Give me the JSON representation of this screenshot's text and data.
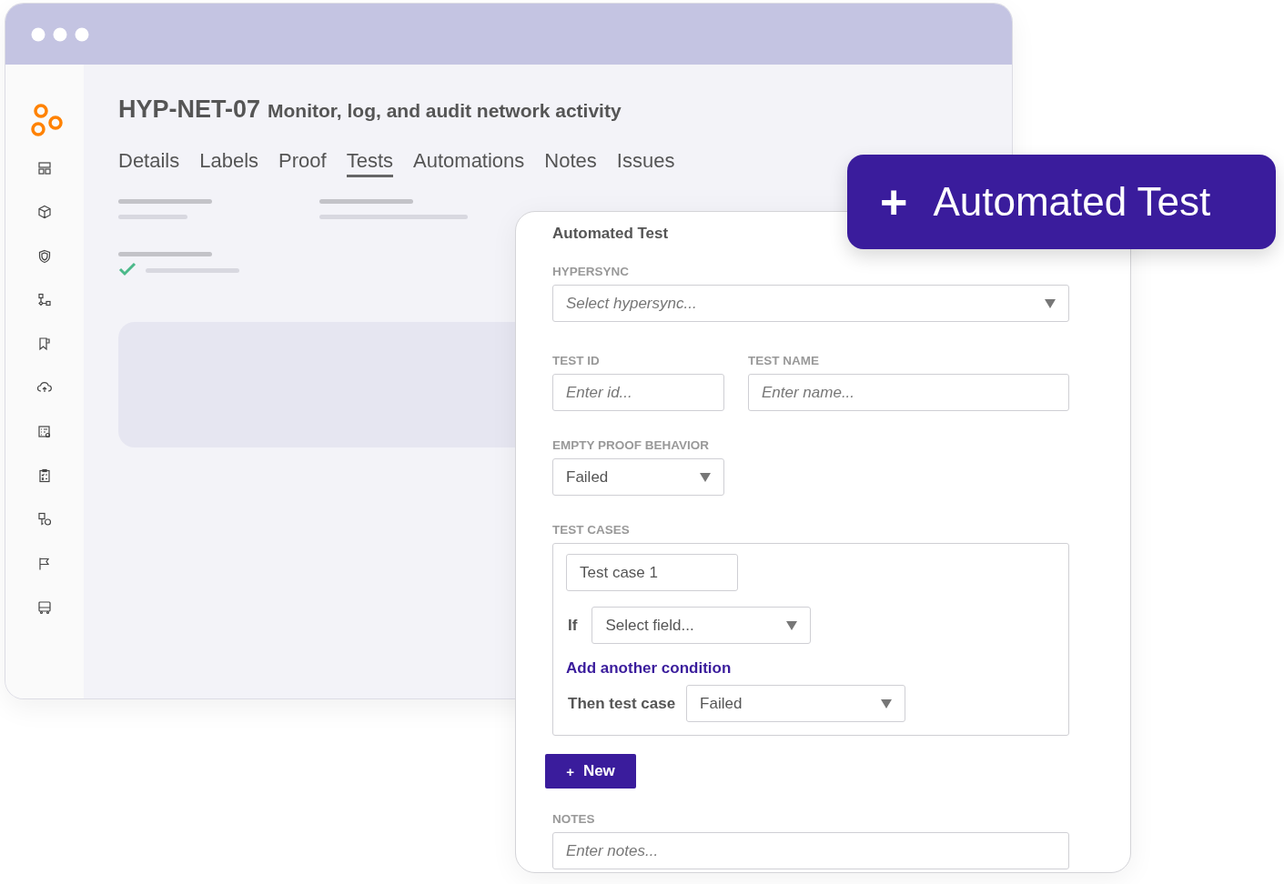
{
  "header": {
    "code": "HYP-NET-07",
    "title": "Monitor, log, and audit network activity"
  },
  "tabs": [
    {
      "label": "Details",
      "selected": false
    },
    {
      "label": "Labels",
      "selected": false
    },
    {
      "label": "Proof",
      "selected": false
    },
    {
      "label": "Tests",
      "selected": true
    },
    {
      "label": "Automations",
      "selected": false
    },
    {
      "label": "Notes",
      "selected": false
    },
    {
      "label": "Issues",
      "selected": false
    }
  ],
  "form": {
    "title": "Automated Test",
    "hypersync": {
      "label": "HYPERSYNC",
      "placeholder": "Select hypersync..."
    },
    "test_id": {
      "label": "TEST ID",
      "placeholder": "Enter id..."
    },
    "test_name": {
      "label": "TEST NAME",
      "placeholder": "Enter name..."
    },
    "empty_proof_behavior": {
      "label": "EMPTY PROOF BEHAVIOR",
      "value": "Failed"
    },
    "test_cases": {
      "label": "TEST CASES",
      "cases": [
        {
          "name": "Test case 1",
          "if_label": "If",
          "field": "Select field...",
          "add_condition": "Add another condition",
          "then_label": "Then test case",
          "then_value": "Failed"
        }
      ]
    },
    "new_button": {
      "icon": "+",
      "label": "New"
    },
    "notes": {
      "label": "NOTES",
      "placeholder": "Enter notes..."
    }
  },
  "badge": {
    "icon": "+",
    "label": "Automated Test"
  }
}
